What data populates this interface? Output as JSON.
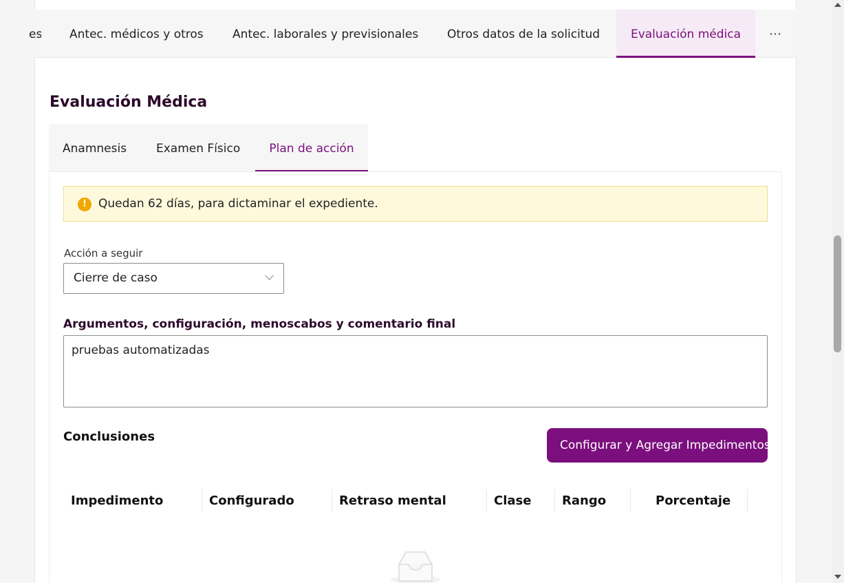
{
  "top_tabs": {
    "items": [
      {
        "label": "es"
      },
      {
        "label": "Antec. médicos y otros"
      },
      {
        "label": "Antec. laborales y previsionales"
      },
      {
        "label": "Otros datos de la solicitud"
      },
      {
        "label": "Evaluación médica",
        "active": true
      }
    ],
    "more_label": "⋯"
  },
  "section": {
    "title": "Evaluación Médica"
  },
  "sub_tabs": {
    "items": [
      {
        "label": "Anamnesis"
      },
      {
        "label": "Examen Físico"
      },
      {
        "label": "Plan de acción",
        "active": true
      }
    ]
  },
  "alert": {
    "icon": "warning-icon",
    "icon_glyph": "!",
    "text": "Quedan 62 días, para dictaminar el expediente."
  },
  "accion": {
    "label": "Acción a seguir",
    "value": "Cierre de caso"
  },
  "argumentos": {
    "label": "Argumentos, configuración, menoscabos y comentario final",
    "value": "pruebas automatizadas"
  },
  "conclusiones": {
    "title": "Conclusiones",
    "button_label": "Configurar y Agregar Impedimentos",
    "columns": [
      "Impedimento",
      "Configurado",
      "Retraso mental",
      "Clase",
      "Rango",
      "Porcentaje"
    ],
    "rows": [],
    "empty_icon": "empty-inbox-icon"
  },
  "colors": {
    "accent": "#7b0f7d",
    "alert_bg": "#fff9dc",
    "alert_icon": "#f0a800"
  }
}
